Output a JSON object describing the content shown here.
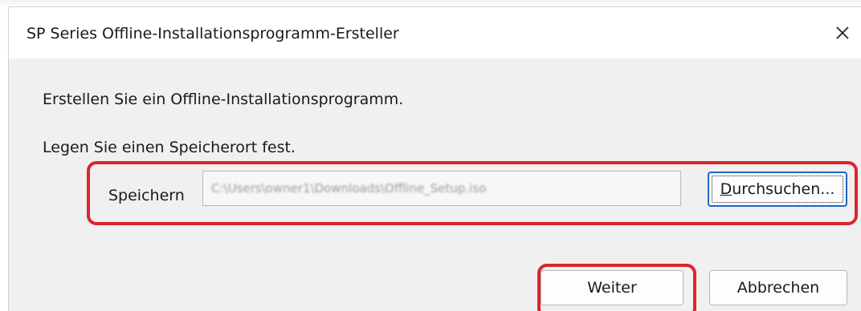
{
  "window": {
    "title": "SP Series Offline-Installationsprogramm-Ersteller",
    "close_icon": "close-icon"
  },
  "content": {
    "intro_text": "Erstellen Sie ein Offline-Installationsprogramm.",
    "location_prompt": "Legen Sie einen Speicherort fest.",
    "save_label": "Speichern",
    "save_path": "C:\\Users\\owner1\\Downloads\\Offline_Setup.iso"
  },
  "buttons": {
    "browse_label": "Durchsuchen...",
    "browse_mnemonic": "D",
    "browse_rest": "urchsuchen...",
    "next_label": "Weiter",
    "cancel_label": "Abbrechen"
  },
  "colors": {
    "highlight": "#d9272e",
    "focus_border": "#1e66c9",
    "dialog_background": "#f0f0f0"
  }
}
